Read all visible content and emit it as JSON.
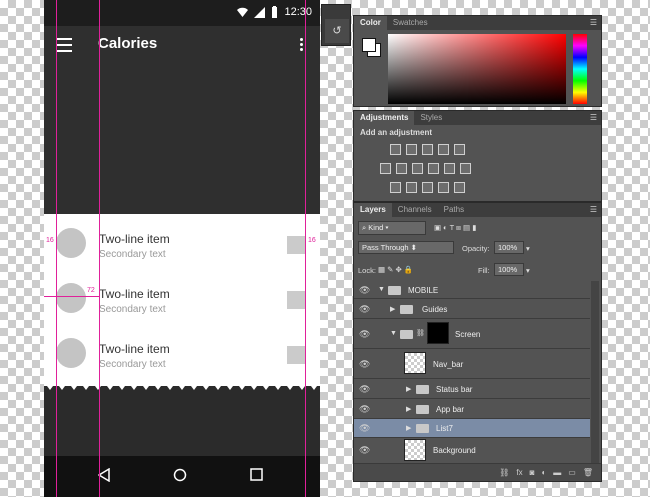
{
  "status_bar": {
    "time": "12:30"
  },
  "app_bar": {
    "title": "Calories"
  },
  "list": {
    "items": [
      {
        "primary": "Two-line item",
        "secondary": "Secondary text"
      },
      {
        "primary": "Two-line item",
        "secondary": "Secondary text"
      },
      {
        "primary": "Two-line item",
        "secondary": "Secondary text"
      }
    ]
  },
  "measurements": {
    "left": "16",
    "right": "16",
    "keyline": "72"
  },
  "photoshop": {
    "color_panel": {
      "tabs": [
        "Color",
        "Swatches"
      ]
    },
    "adjustments_panel": {
      "tabs": [
        "Adjustments",
        "Styles"
      ],
      "heading": "Add an adjustment"
    },
    "layers_panel": {
      "tabs": [
        "Layers",
        "Channels",
        "Paths"
      ],
      "filter": "Kind",
      "blend_mode": "Pass Through",
      "opacity_label": "Opacity:",
      "opacity": "100%",
      "lock_label": "Lock:",
      "fill_label": "Fill:",
      "fill": "100%",
      "layers": [
        "MOBILE",
        "Guides",
        "Screen",
        "Nav_bar",
        "Status bar",
        "App bar",
        "List7",
        "Background"
      ]
    }
  }
}
